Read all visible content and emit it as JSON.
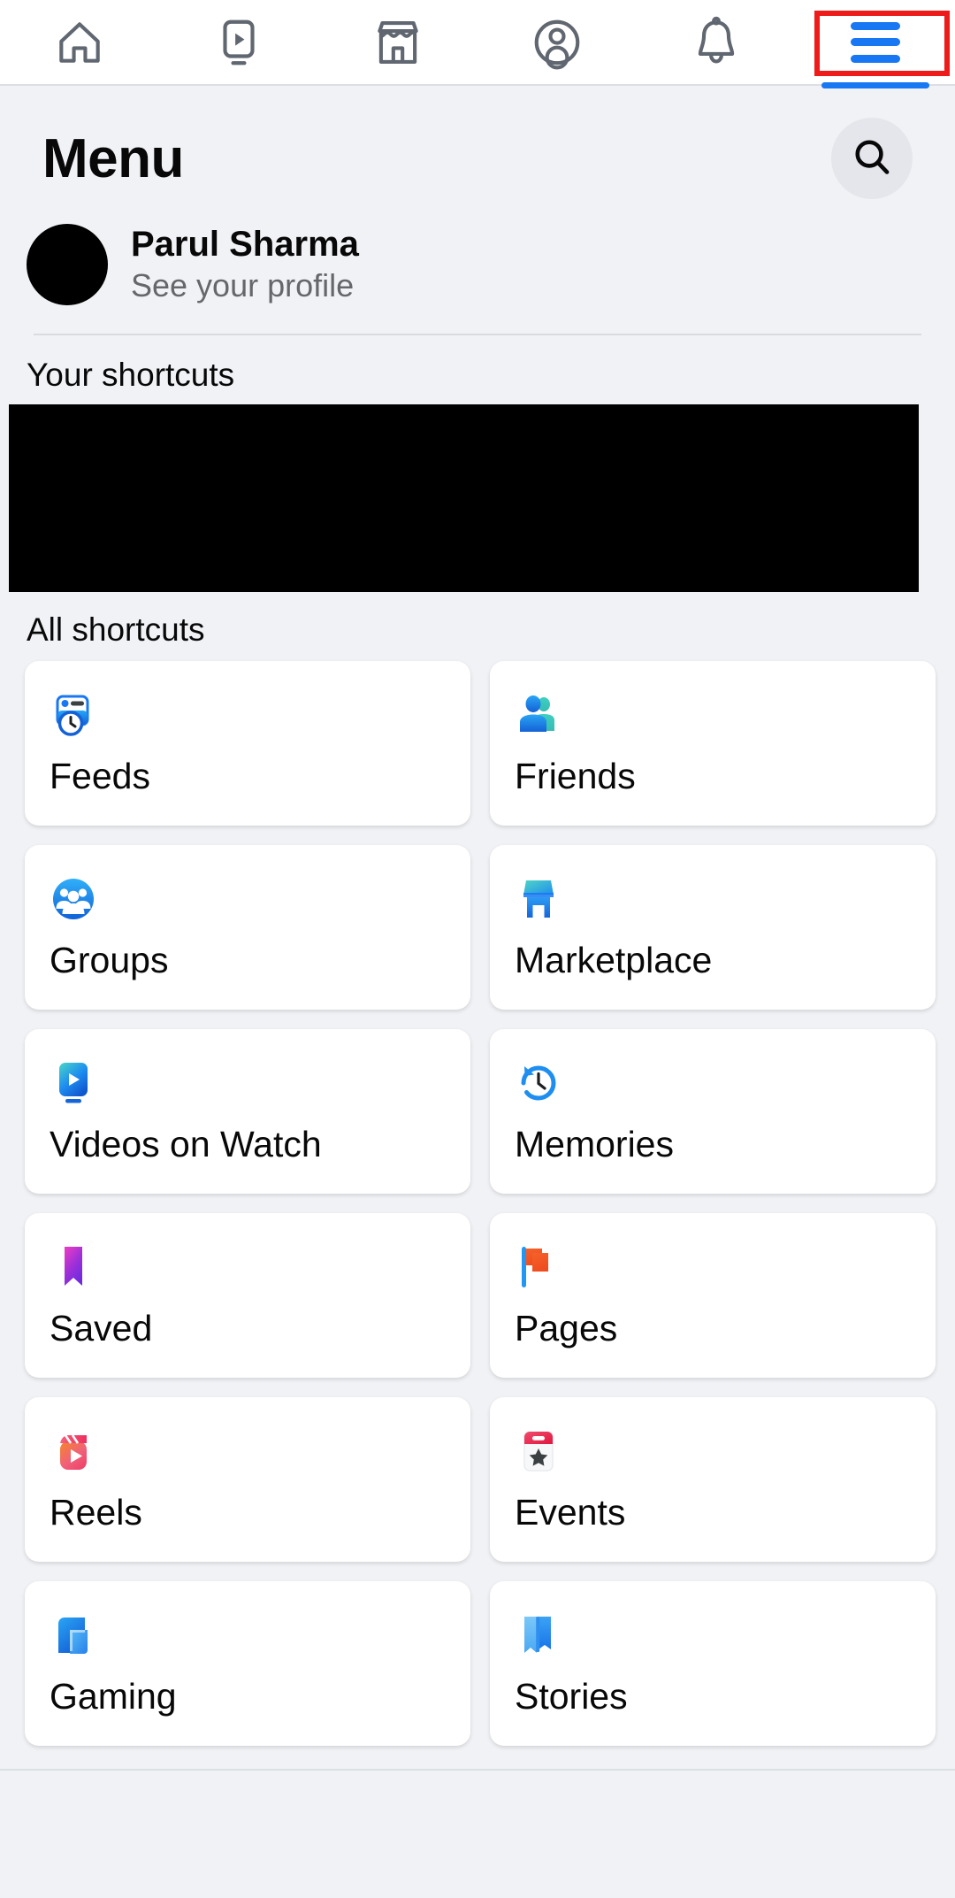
{
  "topbar": {
    "tabs": [
      {
        "name": "home",
        "icon": "home-icon",
        "active": false
      },
      {
        "name": "video",
        "icon": "video-icon",
        "active": false
      },
      {
        "name": "marketplace",
        "icon": "store-icon",
        "active": false
      },
      {
        "name": "profile",
        "icon": "account-circle-icon",
        "active": false
      },
      {
        "name": "notifications",
        "icon": "bell-icon",
        "active": false
      },
      {
        "name": "menu",
        "icon": "hamburger-menu-icon",
        "active": true
      }
    ],
    "active_tab": "menu",
    "active_color": "#1877f2",
    "inactive_color": "#606770",
    "annotation_color": "#ee1b1b"
  },
  "header": {
    "title": "Menu",
    "search_icon": "search-icon"
  },
  "profile": {
    "name": "Parul Sharma",
    "subtitle": "See your profile",
    "avatar": "avatar"
  },
  "sections": {
    "your_shortcuts_title": "Your shortcuts",
    "all_shortcuts_title": "All shortcuts"
  },
  "shortcuts": [
    {
      "label": "Feeds",
      "icon": "feeds-icon"
    },
    {
      "label": "Friends",
      "icon": "friends-icon"
    },
    {
      "label": "Groups",
      "icon": "groups-icon"
    },
    {
      "label": "Marketplace",
      "icon": "marketplace-icon"
    },
    {
      "label": "Videos on Watch",
      "icon": "watch-video-icon"
    },
    {
      "label": "Memories",
      "icon": "memories-clock-icon"
    },
    {
      "label": "Saved",
      "icon": "saved-bookmark-icon"
    },
    {
      "label": "Pages",
      "icon": "pages-flag-icon"
    },
    {
      "label": "Reels",
      "icon": "reels-icon"
    },
    {
      "label": "Events",
      "icon": "events-calendar-icon"
    },
    {
      "label": "Gaming",
      "icon": "gaming-icon"
    },
    {
      "label": "Stories",
      "icon": "stories-book-icon"
    }
  ],
  "colors": {
    "page_background": "#f0f2f5",
    "card_background": "#ffffff",
    "primary_text": "#080809",
    "secondary_text": "#65676b",
    "facebook_blue": "#1877f2"
  }
}
